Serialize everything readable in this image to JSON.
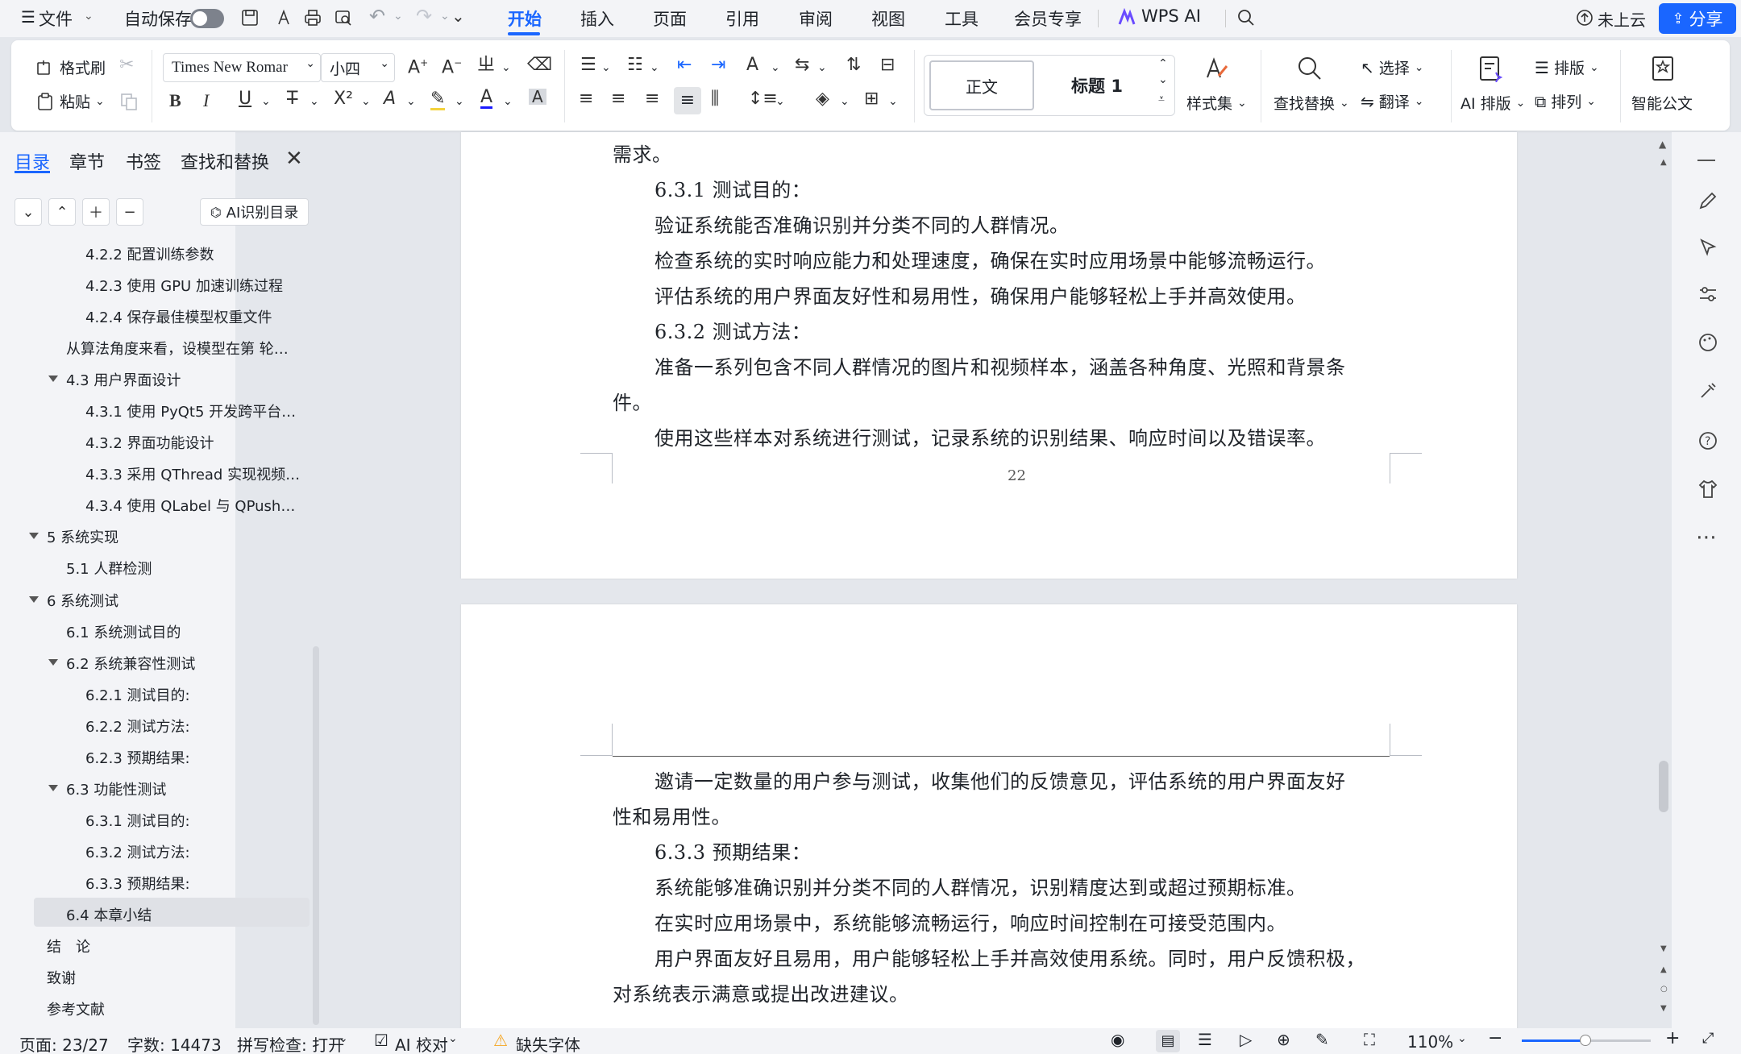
{
  "menubar": {
    "file": "文件",
    "autosave": "自动保存",
    "tabs": [
      "开始",
      "插入",
      "页面",
      "引用",
      "审阅",
      "视图",
      "工具",
      "会员专享"
    ],
    "wps_ai": "WPS AI",
    "cloud": "未上云",
    "share": "分享"
  },
  "ribbon": {
    "format_painter": "格式刷",
    "paste": "粘贴",
    "font_name": "Times New Romar",
    "font_size": "小四",
    "style_normal": "正文",
    "style_heading1": "标题 1",
    "style_set": "样式集",
    "find_replace": "查找替换",
    "select": "选择",
    "translate": "翻译",
    "ai_layout": "AI 排版",
    "layout": "排版",
    "arrange": "排列",
    "smart_doc": "智能公文"
  },
  "navpanel": {
    "tabs": [
      "目录",
      "章节",
      "书签",
      "查找和替换"
    ],
    "ai_toc": "AI识别目录",
    "items": [
      "4.2.2 配置训练参数",
      "4.2.3 使用 GPU 加速训练过程",
      "4.2.4 保存最佳模型权重文件",
      "从算法角度来看，设模型在第 轮…",
      "4.3 用户界面设计",
      "4.3.1 使用 PyQt5 开发跨平台…",
      "4.3.2 界面功能设计",
      "4.3.3 采用 QThread 实现视频…",
      "4.3.4 使用 QLabel 与 QPush…",
      "5 系统实现",
      "5.1 人群检测",
      "6 系统测试",
      "6.1 系统测试目的",
      "6.2 系统兼容性测试",
      "6.2.1 测试目的:",
      "6.2.2 测试方法:",
      "6.2.3 预期结果:",
      "6.3 功能性测试",
      "6.3.1 测试目的:",
      "6.3.2 测试方法:",
      "6.3.3 预期结果:",
      "6.4 本章小结",
      "结　论",
      "致谢",
      "参考文献"
    ]
  },
  "page1": {
    "lines": [
      "需求。",
      "6.3.1 测试目的：",
      "验证系统能否准确识别并分类不同的人群情况。",
      "检查系统的实时响应能力和处理速度，确保在实时应用场景中能够流畅运行。",
      "评估系统的用户界面友好性和易用性，确保用户能够轻松上手并高效使用。",
      "6.3.2 测试方法：",
      "准备一系列包含不同人群情况的图片和视频样本，涵盖各种角度、光照和背景条",
      "件。",
      "使用这些样本对系统进行测试，记录系统的识别结果、响应时间以及错误率。"
    ],
    "page_number": "22"
  },
  "page2": {
    "lines": [
      "邀请一定数量的用户参与测试，收集他们的反馈意见，评估系统的用户界面友好",
      "性和易用性。",
      "6.3.3 预期结果：",
      "系统能够准确识别并分类不同的人群情况，识别精度达到或超过预期标准。",
      "在实时应用场景中，系统能够流畅运行，响应时间控制在可接受范围内。",
      "用户界面友好且易用，用户能够轻松上手并高效使用系统。同时，用户反馈积极，",
      "对系统表示满意或提出改进建议。"
    ]
  },
  "statusbar": {
    "page": "页面: 23/27",
    "words": "字数: 14473",
    "spellcheck": "拼写检查: 打开",
    "ai_proofread": "AI 校对",
    "missing_font": "缺失字体",
    "zoom": "110%"
  },
  "colors": {
    "accent": "#1a66ff",
    "background": "#e4e7ec",
    "panel": "#f3f4f7"
  }
}
